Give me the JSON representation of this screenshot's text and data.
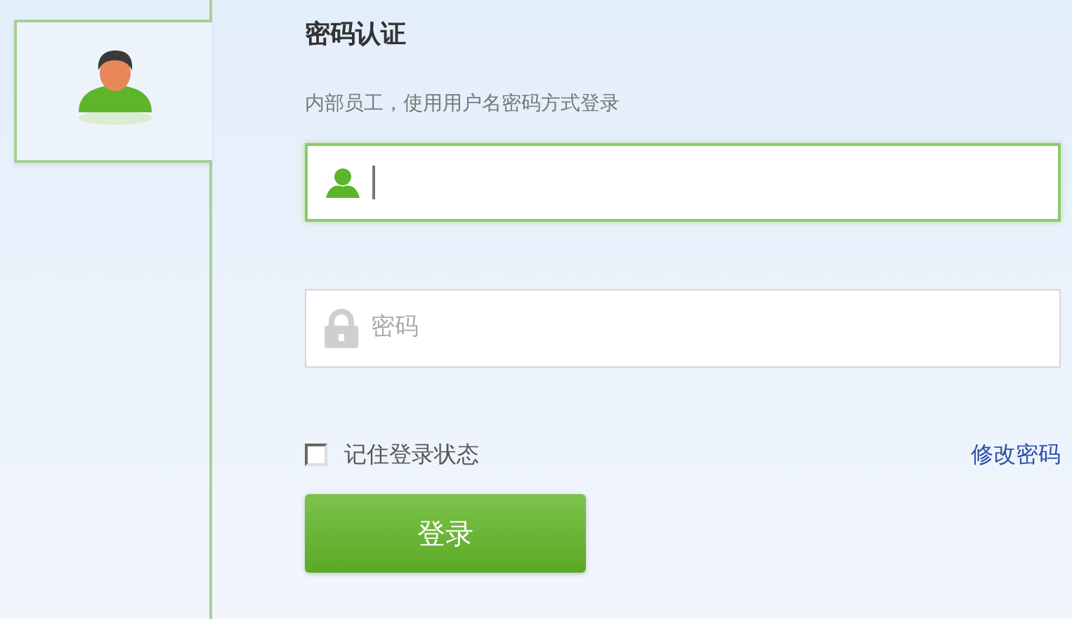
{
  "sidebar": {
    "tabs": [
      {
        "kind": "user",
        "selected": true
      }
    ]
  },
  "form": {
    "title": "密码认证",
    "subtitle": "内部员工，使用用户名密码方式登录",
    "fields": [
      {
        "kind": "user",
        "focused": true
      },
      {
        "kind": "password",
        "placeholder": "密码",
        "focused": false
      }
    ],
    "remember": {
      "label": "记住登录状态",
      "checked": false
    },
    "link": "修改密码",
    "submit": "登录"
  }
}
